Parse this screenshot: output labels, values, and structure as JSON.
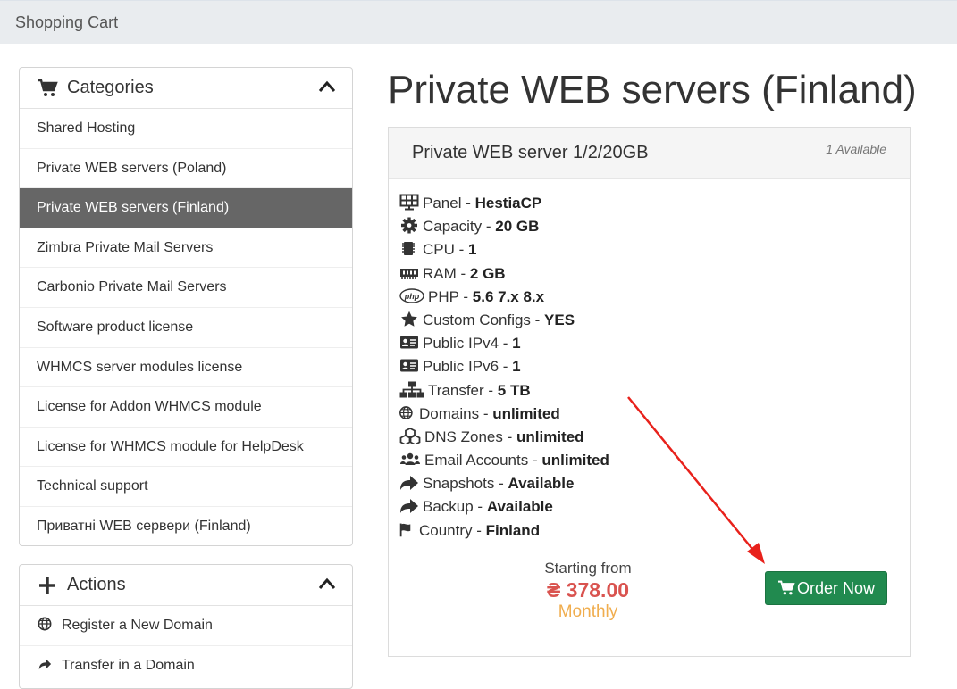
{
  "header": {
    "breadcrumb": "Shopping Cart"
  },
  "categories": {
    "title": "Categories",
    "items": [
      {
        "label": "Shared Hosting"
      },
      {
        "label": "Private WEB servers (Poland)"
      },
      {
        "label": "Private WEB servers (Finland)",
        "active": true
      },
      {
        "label": "Zimbra Private Mail Servers"
      },
      {
        "label": "Carbonio Private Mail Servers"
      },
      {
        "label": "Software product license"
      },
      {
        "label": "WHMCS server modules license"
      },
      {
        "label": "License for Addon WHMCS module"
      },
      {
        "label": "License for WHMCS module for HelpDesk"
      },
      {
        "label": "Technical support"
      },
      {
        "label": "Приватні WEB сервери (Finland)"
      }
    ]
  },
  "actions": {
    "title": "Actions",
    "items": [
      {
        "label": "Register a New Domain",
        "icon": "globe-icon"
      },
      {
        "label": "Transfer in a Domain",
        "icon": "share-arrow-icon"
      }
    ]
  },
  "page": {
    "title": "Private WEB servers (Finland)"
  },
  "product": {
    "name": "Private WEB server 1/2/20GB",
    "availability": "1 Available",
    "features": [
      {
        "label": "Panel",
        "value": "HestiaCP",
        "icon": "panel-icon"
      },
      {
        "label": "Capacity",
        "value": "20 GB",
        "icon": "gear-icon"
      },
      {
        "label": "CPU",
        "value": "1",
        "icon": "cpu-icon"
      },
      {
        "label": "RAM",
        "value": "2 GB",
        "icon": "ram-icon"
      },
      {
        "label": "PHP",
        "value": "5.6 7.x 8.x",
        "icon": "php-icon"
      },
      {
        "label": "Custom Configs",
        "value": "YES",
        "icon": "star-icon"
      },
      {
        "label": "Public IPv4",
        "value": "1",
        "icon": "id-card-icon"
      },
      {
        "label": "Public IPv6",
        "value": "1",
        "icon": "id-card-icon"
      },
      {
        "label": "Transfer",
        "value": "5 TB",
        "icon": "sitemap-icon"
      },
      {
        "label": "Domains",
        "value": "unlimited",
        "icon": "globe-icon"
      },
      {
        "label": "DNS Zones",
        "value": "unlimited",
        "icon": "cubes-icon"
      },
      {
        "label": "Email Accounts",
        "value": "unlimited",
        "icon": "users-icon"
      },
      {
        "label": "Snapshots",
        "value": "Available",
        "icon": "share-arrow-icon"
      },
      {
        "label": "Backup",
        "value": "Available",
        "icon": "share-arrow-icon"
      },
      {
        "label": "Country",
        "value": "Finland",
        "icon": "flag-icon"
      }
    ],
    "pricing": {
      "starting_from": "Starting from",
      "price": "₴ 378.00",
      "cycle": "Monthly"
    },
    "order_button": "Order Now"
  },
  "colors": {
    "active_item_bg": "#666666",
    "order_button": "#218a4f",
    "price": "#d9534f",
    "cycle": "#f0ad4e",
    "arrow": "#e8211b"
  }
}
